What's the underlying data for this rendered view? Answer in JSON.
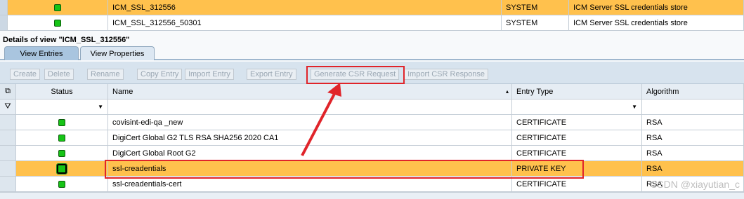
{
  "top_rows": [
    {
      "name": "ICM_SSL_312556",
      "source": "SYSTEM",
      "description": "ICM Server SSL credentials store"
    },
    {
      "name": "ICM_SSL_312556_50301",
      "source": "SYSTEM",
      "description": "ICM Server SSL credentials store"
    }
  ],
  "details_title": "Details of view \"ICM_SSL_312556\"",
  "tabs": [
    "View Entries",
    "View Properties"
  ],
  "toolbar": [
    "Create",
    "Delete",
    "Rename",
    "Copy Entry",
    "Import Entry",
    "Export Entry",
    "Generate CSR Request",
    "Import CSR Response"
  ],
  "columns": [
    "Status",
    "Name",
    "Entry Type",
    "Algorithm"
  ],
  "entries": [
    {
      "name": "covisint-edi-qa        _new",
      "type": "CERTIFICATE",
      "algorithm": "RSA"
    },
    {
      "name": "DigiCert Global G2 TLS RSA SHA256 2020 CA1",
      "type": "CERTIFICATE",
      "algorithm": "RSA"
    },
    {
      "name": "DigiCert Global Root G2",
      "type": "CERTIFICATE",
      "algorithm": "RSA"
    },
    {
      "name": "ssl-creadentials",
      "type": "PRIVATE KEY",
      "algorithm": "RSA"
    },
    {
      "name": "ssl-creadentials-cert",
      "type": "CERTIFICATE",
      "algorithm": "RSA"
    }
  ],
  "colors": {
    "selected": "#ffc14d",
    "highlight": "#e0242a",
    "status_green": "#16c416"
  },
  "watermark": "CSDN @xiayutian_c"
}
